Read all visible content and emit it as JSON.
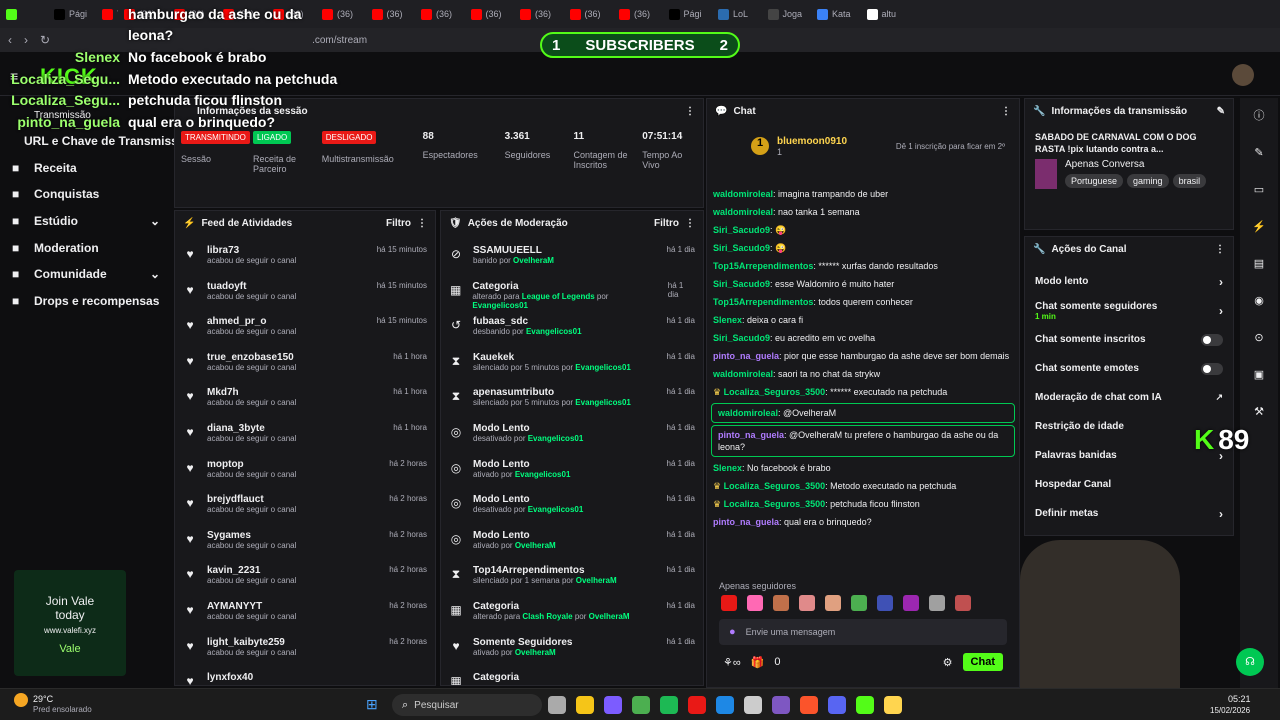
{
  "browser": {
    "tabs": [
      {
        "label": "",
        "color": "#53fc18",
        "icon": "kick-icon"
      },
      {
        "label": "Pági",
        "color": "#000000",
        "icon": "x-icon"
      },
      {
        "label": "Yo",
        "color": "#ff0000",
        "icon": "youtube-icon"
      },
      {
        "label": "(36)",
        "color": "#ff0000",
        "icon": "youtube-icon"
      },
      {
        "label": "(36)",
        "color": "#ff0000",
        "icon": "youtube-icon"
      },
      {
        "label": "(36)",
        "color": "#ff0000",
        "icon": "youtube-icon"
      },
      {
        "label": "(36)",
        "color": "#ff0000",
        "icon": "youtube-icon"
      },
      {
        "label": "(36)",
        "color": "#ff0000",
        "icon": "youtube-icon"
      },
      {
        "label": "(36)",
        "color": "#ff0000",
        "icon": "youtube-icon"
      },
      {
        "label": "(36)",
        "color": "#ff0000",
        "icon": "youtube-icon"
      },
      {
        "label": "(36)",
        "color": "#ff0000",
        "icon": "youtube-icon"
      },
      {
        "label": "(36)",
        "color": "#ff0000",
        "icon": "youtube-icon"
      },
      {
        "label": "(36)",
        "color": "#ff0000",
        "icon": "youtube-icon"
      },
      {
        "label": "(36)",
        "color": "#ff0000",
        "icon": "youtube-icon"
      },
      {
        "label": "Pági",
        "color": "#000000",
        "icon": "x-icon"
      },
      {
        "label": "LoL",
        "color": "#2b6cb0",
        "icon": "lol-icon"
      },
      {
        "label": "Joga",
        "color": "#444444",
        "icon": "game-icon"
      },
      {
        "label": "Kata",
        "color": "#3b82f6",
        "icon": "kata-icon"
      },
      {
        "label": "altu",
        "color": "#ffffff",
        "icon": "google-icon"
      }
    ],
    "url": ".com/stream"
  },
  "overlay": {
    "subscribers_label": "SUBSCRIBERS",
    "sub_left": "1",
    "sub_right": "2",
    "kick_count": "89",
    "chat": [
      {
        "name": "",
        "text": "hamburgao da ashe ou da"
      },
      {
        "name": "",
        "text": "leona?"
      },
      {
        "name": "Slenex",
        "text": "No facebook é brabo"
      },
      {
        "name": "Localiza_Segu...",
        "text": "Metodo executado na petchuda"
      },
      {
        "name": "Localiza_Segu...",
        "text": "petchuda ficou flinston"
      },
      {
        "name": "pinto_na_guela",
        "text": "qual era o brinquedo?"
      }
    ]
  },
  "sidebar": {
    "transmissao": "Transmissão",
    "items": [
      {
        "label": "URL e Chave de Transmissão",
        "icon": "key-icon",
        "chevron": false
      },
      {
        "label": "Receita",
        "icon": "revenue-icon",
        "chevron": false
      },
      {
        "label": "Conquistas",
        "icon": "trophy-icon",
        "chevron": false
      },
      {
        "label": "Estúdio",
        "icon": "studio-icon",
        "chevron": true
      },
      {
        "label": "Moderation",
        "icon": "wrench-icon",
        "chevron": false
      },
      {
        "label": "Comunidade",
        "icon": "community-icon",
        "chevron": true
      },
      {
        "label": "Drops e recompensas",
        "icon": "gift-icon",
        "chevron": false
      }
    ],
    "ad": {
      "line1": "Join Vale",
      "line2": "today",
      "site": "www.valefi.xyz",
      "button": "Vale"
    }
  },
  "session": {
    "title": "Informações da sessão",
    "badges": [
      {
        "text": "TRANSMITINDO",
        "label": "Sessão",
        "color": "#e91916"
      },
      {
        "text": "LIGADO",
        "label": "Receita de Parceiro",
        "color": "#00c853"
      },
      {
        "text": "DESLIGADO",
        "label": "Multistransmissão",
        "color": "#e91916"
      }
    ],
    "stats": [
      {
        "value": "88",
        "label": "Espectadores"
      },
      {
        "value": "3.361",
        "label": "Seguidores"
      },
      {
        "value": "11",
        "label": "Contagem de Inscritos"
      },
      {
        "value": "07:51:14",
        "label": "Tempo Ao Vivo"
      }
    ]
  },
  "activity": {
    "title": "Feed de Atividades",
    "filter": "Filtro",
    "items": [
      {
        "name": "libra73",
        "sub": "acabou de seguir o canal",
        "time": "há 15 minutos"
      },
      {
        "name": "tuadoyft",
        "sub": "acabou de seguir o canal",
        "time": "há 15 minutos"
      },
      {
        "name": "ahmed_pr_o",
        "sub": "acabou de seguir o canal",
        "time": "há 15 minutos"
      },
      {
        "name": "true_enzobase150",
        "sub": "acabou de seguir o canal",
        "time": "há 1 hora"
      },
      {
        "name": "Mkd7h",
        "sub": "acabou de seguir o canal",
        "time": "há 1 hora"
      },
      {
        "name": "diana_3byte",
        "sub": "acabou de seguir o canal",
        "time": "há 1 hora"
      },
      {
        "name": "moptop",
        "sub": "acabou de seguir o canal",
        "time": "há 2 horas"
      },
      {
        "name": "brejydflauct",
        "sub": "acabou de seguir o canal",
        "time": "há 2 horas"
      },
      {
        "name": "Sygames",
        "sub": "acabou de seguir o canal",
        "time": "há 2 horas"
      },
      {
        "name": "kavin_2231",
        "sub": "acabou de seguir o canal",
        "time": "há 2 horas"
      },
      {
        "name": "AYMANYYT",
        "sub": "acabou de seguir o canal",
        "time": "há 2 horas"
      },
      {
        "name": "light_kaibyte259",
        "sub": "acabou de seguir o canal",
        "time": "há 2 horas"
      },
      {
        "name": "lynxfox40",
        "sub": "",
        "time": ""
      }
    ]
  },
  "moderation": {
    "title": "Ações de Moderação",
    "filter": "Filtro",
    "items": [
      {
        "name": "SSAMUUEELL",
        "pre": "banido por ",
        "mid": "",
        "by": "OvelheraM",
        "time": "há 1 dia",
        "icon": "ban-icon"
      },
      {
        "name": "Categoria",
        "pre": "alterado para ",
        "mid": "League of Legends",
        "by": "Evangelicos01",
        "time": "há 1 dia",
        "icon": "category-icon"
      },
      {
        "name": "fubaas_sdc",
        "pre": "desbanido por ",
        "mid": "",
        "by": "Evangelicos01",
        "time": "há 1 dia",
        "icon": "unban-icon"
      },
      {
        "name": "Kauekek",
        "pre": "silenciado por 5 minutos por ",
        "mid": "",
        "by": "Evangelicos01",
        "time": "há 1 dia",
        "icon": "hourglass-icon"
      },
      {
        "name": "apenasumtributo",
        "pre": "silenciado por 5 minutos por ",
        "mid": "",
        "by": "Evangelicos01",
        "time": "há 1 dia",
        "icon": "hourglass-icon"
      },
      {
        "name": "Modo Lento",
        "pre": "desativado por ",
        "mid": "",
        "by": "Evangelicos01",
        "time": "há 1 dia",
        "icon": "snail-icon"
      },
      {
        "name": "Modo Lento",
        "pre": "ativado por ",
        "mid": "",
        "by": "Evangelicos01",
        "time": "há 1 dia",
        "icon": "snail-icon"
      },
      {
        "name": "Modo Lento",
        "pre": "desativado por ",
        "mid": "",
        "by": "Evangelicos01",
        "time": "há 1 dia",
        "icon": "snail-icon"
      },
      {
        "name": "Modo Lento",
        "pre": "ativado por ",
        "mid": "",
        "by": "OvelheraM",
        "time": "há 1 dia",
        "icon": "snail-icon"
      },
      {
        "name": "Top14Arrependimentos",
        "pre": "silenciado por 1 semana por ",
        "mid": "",
        "by": "OvelheraM",
        "time": "há 1 dia",
        "icon": "hourglass-icon"
      },
      {
        "name": "Categoria",
        "pre": "alterado para ",
        "mid": "Clash Royale",
        "by": "OvelheraM",
        "time": "há 1 dia",
        "icon": "category-icon"
      },
      {
        "name": "Somente Seguidores",
        "pre": "ativado por ",
        "mid": "",
        "by": "OvelheraM",
        "time": "há 1 dia",
        "icon": "heart-icon"
      },
      {
        "name": "Categoria",
        "pre": "",
        "mid": "",
        "by": "",
        "time": "",
        "icon": "category-icon"
      }
    ]
  },
  "chat": {
    "title": "Chat",
    "pinned_user": "bluemoon0910",
    "pinned_count": "1",
    "gift_text": "Dê 1 inscrição para ficar em 2º",
    "messages": [
      {
        "user": "waldomiroleal",
        "text": ": imagina trampando de uber",
        "color": "green",
        "hl": false,
        "badge": false
      },
      {
        "user": "waldomiroleal",
        "text": ": nao tanka 1 semana",
        "color": "green",
        "hl": false,
        "badge": false
      },
      {
        "user": "Siri_Sacudo9",
        "text": ": 😜",
        "color": "green",
        "hl": false,
        "badge": false
      },
      {
        "user": "Siri_Sacudo9",
        "text": ": 😜",
        "color": "green",
        "hl": false,
        "badge": false
      },
      {
        "user": "Top15Arrependimentos",
        "text": ": ****** xurfas dando resultados",
        "color": "green",
        "hl": false,
        "badge": false
      },
      {
        "user": "Siri_Sacudo9",
        "text": ": esse Waldomiro é muito hater",
        "color": "green",
        "hl": false,
        "badge": false
      },
      {
        "user": "Top15Arrependimentos",
        "text": ": todos querem conhecer",
        "color": "green",
        "hl": false,
        "badge": false
      },
      {
        "user": "Slenex",
        "text": ": deixa o cara fi",
        "color": "green",
        "hl": false,
        "badge": false
      },
      {
        "user": "Siri_Sacudo9",
        "text": ": eu acredito em vc ovelha",
        "color": "green",
        "hl": false,
        "badge": false
      },
      {
        "user": "pinto_na_guela",
        "text": ": pior que esse hamburgao da ashe deve ser bom demais",
        "color": "purple",
        "hl": false,
        "badge": false
      },
      {
        "user": "waldomiroleal",
        "text": ": saori ta no chat da strykw",
        "color": "green",
        "hl": false,
        "badge": false
      },
      {
        "user": "Localiza_Seguros_3500",
        "text": ": ****** executado na petchuda",
        "color": "green",
        "hl": false,
        "badge": true
      },
      {
        "user": "waldomiroleal",
        "text": ": @OvelheraM",
        "color": "green",
        "hl": true,
        "badge": false
      },
      {
        "user": "pinto_na_guela",
        "text": ": @OvelheraM tu prefere o hamburgao da ashe ou da leona?",
        "color": "purple",
        "hl": true,
        "badge": false
      },
      {
        "user": "Slenex",
        "text": ": No facebook é brabo",
        "color": "green",
        "hl": false,
        "badge": false
      },
      {
        "user": "Localiza_Seguros_3500",
        "text": ": Metodo executado na petchuda",
        "color": "green",
        "hl": false,
        "badge": true
      },
      {
        "user": "Localiza_Seguros_3500",
        "text": ": petchuda ficou flinston",
        "color": "green",
        "hl": false,
        "badge": true
      },
      {
        "user": "pinto_na_guela",
        "text": ": qual era o brinquedo?",
        "color": "purple",
        "hl": false,
        "badge": false
      }
    ],
    "followers_only": "Apenas seguidores",
    "placeholder": "Envie uma mensagem",
    "points": "0",
    "send": "Chat"
  },
  "stream_info": {
    "title": "Informações da transmissão",
    "stream_title": "SABADO DE CARNAVAL COM O DOG RASTA !pix lutando contra a...",
    "category": "Apenas Conversa",
    "tags": [
      "Portuguese",
      "gaming",
      "brasil"
    ]
  },
  "channel_actions": {
    "title": "Ações do Canal",
    "items": [
      {
        "label": "Modo lento",
        "sub": "",
        "control": "chevron"
      },
      {
        "label": "Chat somente seguidores",
        "sub": "1 min",
        "control": "chevron"
      },
      {
        "label": "Chat somente inscritos",
        "sub": "",
        "control": "toggle"
      },
      {
        "label": "Chat somente emotes",
        "sub": "",
        "control": "toggle"
      },
      {
        "label": "Moderação de chat com IA",
        "sub": "",
        "control": "external"
      },
      {
        "label": "Restrição de idade",
        "sub": "",
        "control": "none"
      },
      {
        "label": "Palavras banidas",
        "sub": "",
        "control": "chevron"
      },
      {
        "label": "Hospedar Canal",
        "sub": "",
        "control": "none"
      },
      {
        "label": "Definir metas",
        "sub": "",
        "control": "chevron"
      }
    ]
  },
  "taskbar": {
    "weather_temp": "29°C",
    "weather_desc": "Pred ensolarado",
    "search": "Pesquisar",
    "time": "05:21",
    "date": "15/02/2026"
  }
}
